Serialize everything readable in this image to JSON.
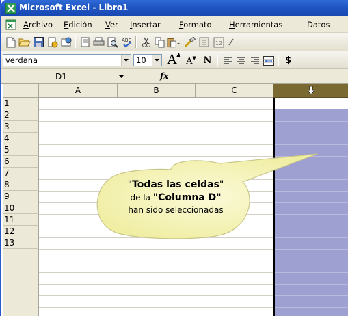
{
  "window": {
    "title": "Microsoft Excel - Libro1"
  },
  "menu": {
    "items": [
      {
        "accel": "A",
        "rest": "rchivo"
      },
      {
        "accel": "E",
        "rest": "dición"
      },
      {
        "accel": "V",
        "rest": "er"
      },
      {
        "accel": "I",
        "rest": "nsertar"
      },
      {
        "accel": "F",
        "rest": "ormato"
      },
      {
        "accel": "H",
        "rest": "erramientas"
      },
      {
        "accel": "",
        "rest": "Datos"
      }
    ]
  },
  "toolbar": {
    "icons": [
      "new-icon",
      "open-icon",
      "save-icon",
      "permission-icon",
      "email-icon",
      "print-preview-icon",
      "print-icon",
      "search-icon",
      "spelling-icon",
      "cut-icon",
      "copy-icon",
      "paste-icon",
      "format-painter-icon",
      "research-icon",
      "calendar-icon",
      "undo-icon"
    ]
  },
  "format_bar": {
    "font": "verdana",
    "size": "10",
    "grow_font": "A",
    "shrink_font": "A",
    "bold": "N",
    "currency": "$"
  },
  "formula_bar": {
    "name_box": "D1",
    "fx": "fx",
    "value": ""
  },
  "grid": {
    "columns": [
      "A",
      "B",
      "C",
      ""
    ],
    "rows": [
      "1",
      "2",
      "3",
      "4",
      "5",
      "6",
      "7",
      "8",
      "9",
      "10",
      "11",
      "12",
      "13"
    ],
    "selected_column": "D",
    "active_cell": "D1"
  },
  "callout": {
    "line1_q_open": "\"",
    "line1_bold": "Todas las celdas",
    "line1_q_close": "\"",
    "line2_pre": "de la ",
    "line2_bold": "\"Columna D\"",
    "line3": "han sido seleccionadas"
  },
  "colors": {
    "titlebar": "#1f55c2",
    "selection": "#9ea0d2",
    "selected_header": "#7a6a32",
    "callout": "#f5f3b8"
  }
}
